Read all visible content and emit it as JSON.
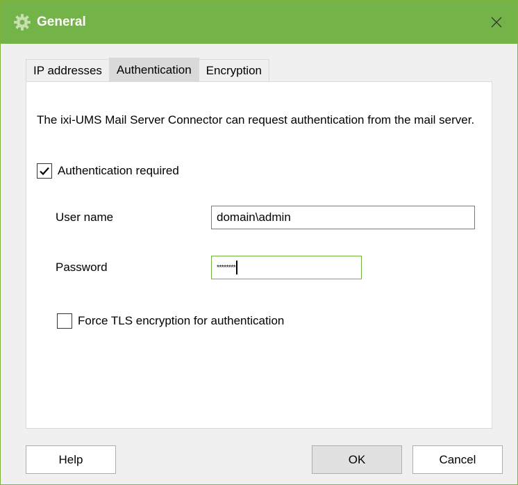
{
  "window": {
    "title": "General",
    "icon": "gear-icon",
    "close_icon": "close-icon",
    "accent_color": "#74b347"
  },
  "tabs": [
    {
      "label": "IP addresses",
      "active": false
    },
    {
      "label": "Authentication",
      "active": true
    },
    {
      "label": "Encryption",
      "active": false
    }
  ],
  "auth": {
    "description": "The ixi-UMS Mail Server Connector can request authentication from the mail server.",
    "auth_required_label": "Authentication required",
    "auth_required_checked": true,
    "username_label": "User name",
    "username_value": "domain\\admin",
    "password_label": "Password",
    "password_value": "********",
    "force_tls_label": "Force TLS encryption for authentication",
    "force_tls_checked": false
  },
  "buttons": {
    "help": "Help",
    "ok": "OK",
    "cancel": "Cancel"
  }
}
